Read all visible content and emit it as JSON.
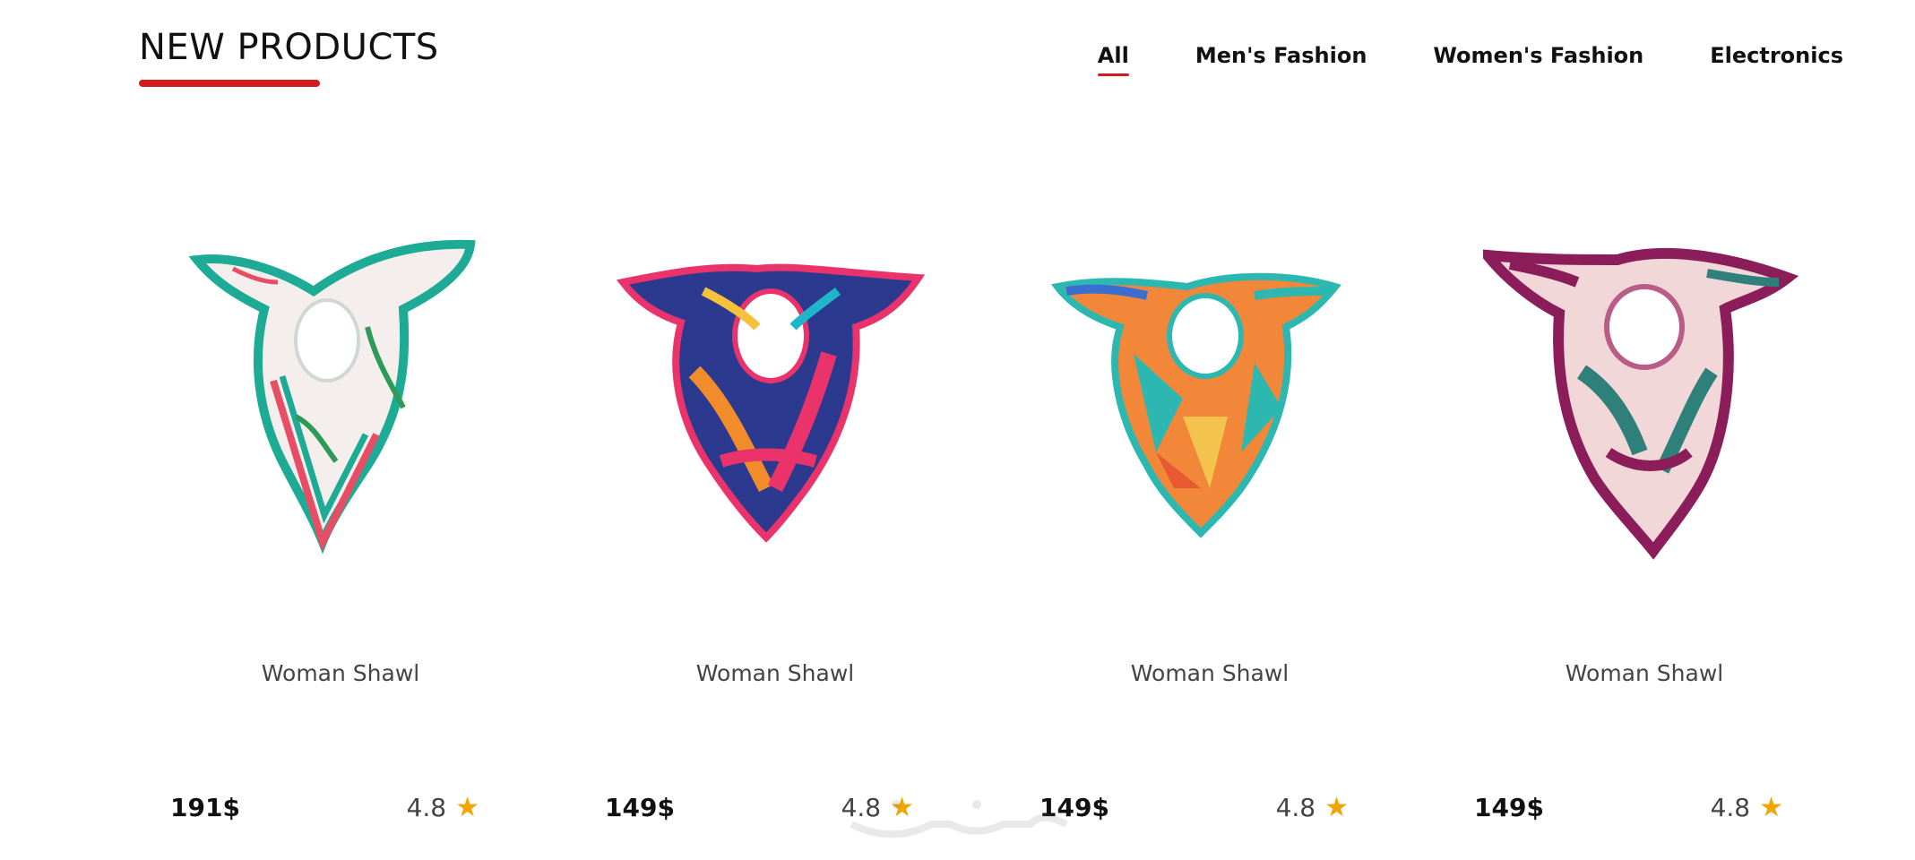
{
  "section": {
    "title": "NEW PRODUCTS",
    "accent_color": "#d21a1f"
  },
  "filters": {
    "tabs": [
      {
        "label": "All",
        "active": true
      },
      {
        "label": "Men's Fashion",
        "active": false
      },
      {
        "label": "Women's Fashion",
        "active": false
      },
      {
        "label": "Electronics",
        "active": false
      }
    ]
  },
  "products": [
    {
      "name": "Woman Shawl",
      "price": "191$",
      "rating": "4.8",
      "image": "floral-white-teal-scarf"
    },
    {
      "name": "Woman Shawl",
      "price": "149$",
      "rating": "4.8",
      "image": "navy-pink-abstract-scarf"
    },
    {
      "name": "Woman Shawl",
      "price": "149$",
      "rating": "4.8",
      "image": "orange-teal-geometric-scarf"
    },
    {
      "name": "Woman Shawl",
      "price": "149$",
      "rating": "4.8",
      "image": "burgundy-pink-leaf-scarf"
    }
  ],
  "icons": {
    "star": "star-icon"
  },
  "colors": {
    "star": "#f0a500",
    "text": "#111111",
    "muted_text": "#444444"
  }
}
